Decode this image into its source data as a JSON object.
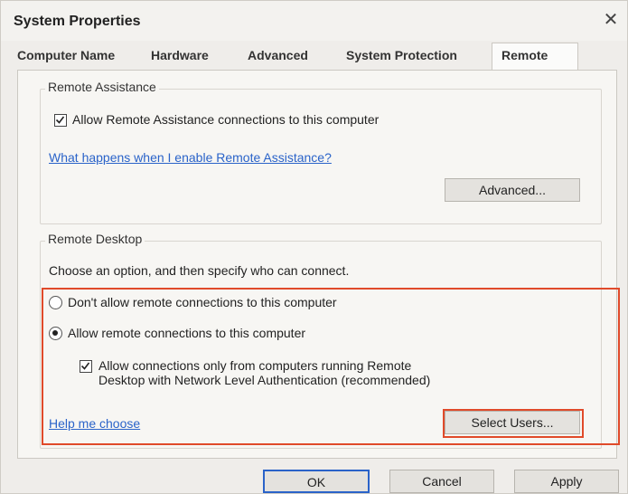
{
  "window": {
    "title": "System Properties"
  },
  "tabs": [
    {
      "label": "Computer Name"
    },
    {
      "label": "Hardware"
    },
    {
      "label": "Advanced"
    },
    {
      "label": "System Protection"
    },
    {
      "label": "Remote",
      "active": true
    }
  ],
  "remote_assistance": {
    "group_title": "Remote Assistance",
    "allow_label": "Allow Remote Assistance connections to this computer",
    "allow_checked": true,
    "help_link": "What happens when I enable Remote Assistance?",
    "advanced_button": "Advanced..."
  },
  "remote_desktop": {
    "group_title": "Remote Desktop",
    "instruction": "Choose an option, and then specify who can connect.",
    "option_deny": "Don't allow remote connections to this computer",
    "option_allow": "Allow remote connections to this computer",
    "selected_option": "allow",
    "nla_label_line1": "Allow connections only from computers running Remote",
    "nla_label_line2": "Desktop with Network Level Authentication (recommended)",
    "nla_checked": true,
    "help_link": "Help me choose",
    "select_users_button": "Select Users..."
  },
  "footer": {
    "ok_button": "OK",
    "cancel_button": "Cancel",
    "apply_button": "Apply"
  },
  "colors": {
    "highlight": "#e04a2a",
    "link": "#2a63c9"
  }
}
